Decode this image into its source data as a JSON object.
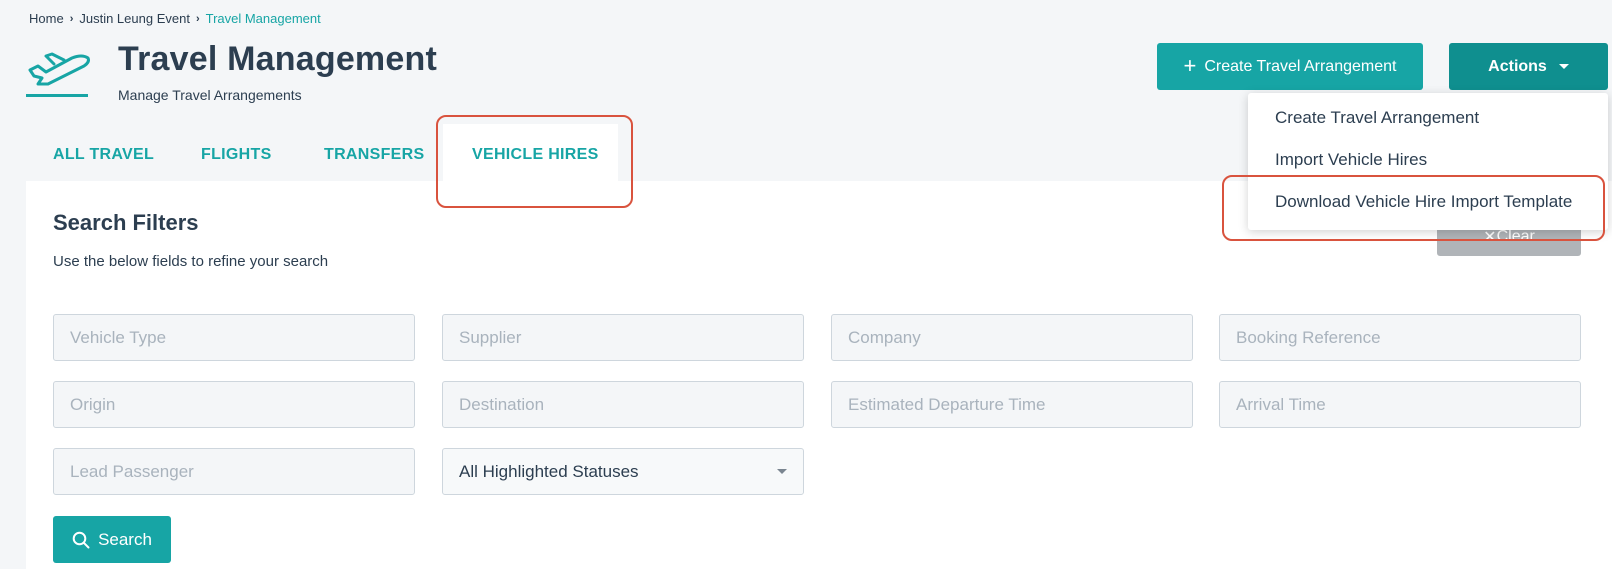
{
  "breadcrumb": {
    "items": [
      "Home",
      "Justin Leung Event"
    ],
    "current": "Travel Management"
  },
  "header": {
    "title": "Travel Management",
    "subtitle": "Manage Travel Arrangements",
    "create_button": "Create Travel Arrangement",
    "actions_button": "Actions"
  },
  "tabs": [
    {
      "label": "ALL TRAVEL"
    },
    {
      "label": "FLIGHTS"
    },
    {
      "label": "TRANSFERS"
    },
    {
      "label": "VEHICLE HIRES",
      "active": true
    }
  ],
  "actions_menu": {
    "items": [
      "Create Travel Arrangement",
      "Import Vehicle Hires",
      "Download Vehicle Hire Import Template"
    ]
  },
  "filters": {
    "title": "Search Filters",
    "subtitle": "Use the below fields to refine your search",
    "clear_button": "Clear",
    "fields": {
      "vehicle_type": "Vehicle Type",
      "supplier": "Supplier",
      "company": "Company",
      "booking_reference": "Booking Reference",
      "origin": "Origin",
      "destination": "Destination",
      "estimated_departure_time": "Estimated Departure Time",
      "arrival_time": "Arrival Time",
      "lead_passenger": "Lead Passenger"
    },
    "status_select": "All Highlighted Statuses",
    "search_button": "Search"
  },
  "colors": {
    "accent": "#17a5a5",
    "accent_dark": "#0f8f8f",
    "highlight": "#d9533e",
    "text": "#2c3e50"
  },
  "icons": {
    "header": "airplane-icon",
    "search": "search-icon",
    "clear": "close-icon"
  }
}
